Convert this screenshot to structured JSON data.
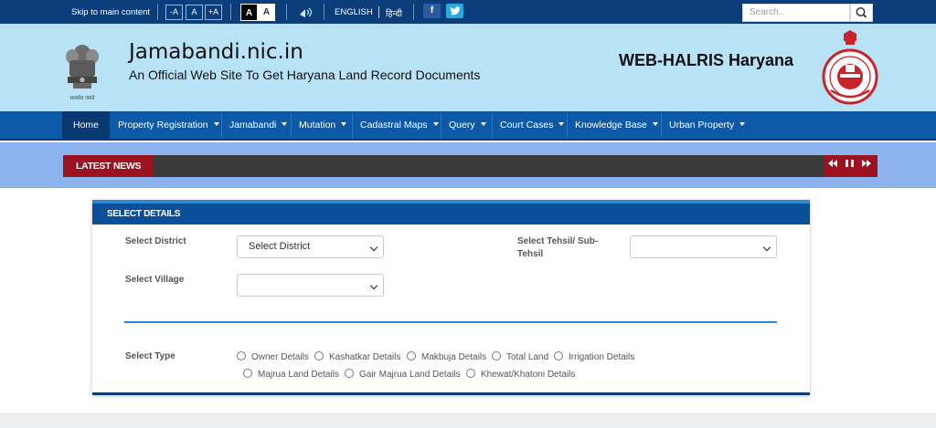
{
  "topbar": {
    "skip_link": "Skip to main content",
    "font_decrease": "-A",
    "font_normal": "A",
    "font_increase": "+A",
    "contrast_dark": "A",
    "contrast_light": "A",
    "lang_english": "ENGLISH",
    "lang_hindi": "हिन्दी",
    "facebook": "f",
    "twitter": "t",
    "search_placeholder": "Search.."
  },
  "header": {
    "title": "Jamabandi.nic.in",
    "subtitle": "An Official Web Site To Get Haryana Land Record Documents",
    "right_title": "WEB-HALRIS Haryana",
    "emblem_caption": "सत्यमेव जयते"
  },
  "nav": {
    "items": [
      {
        "label": "Home"
      },
      {
        "label": "Property Registration"
      },
      {
        "label": "Jamabandi"
      },
      {
        "label": "Mutation"
      },
      {
        "label": "Cadastral Maps"
      },
      {
        "label": "Query"
      },
      {
        "label": "Court Cases"
      },
      {
        "label": "Knowledge Base"
      },
      {
        "label": "Urban Property"
      }
    ]
  },
  "news": {
    "label": "LATEST NEWS",
    "controls": "◀◀ ❚❚ ▶▶"
  },
  "form": {
    "heading": "SELECT DETAILS",
    "district_label": "Select District",
    "district_value": "Select District",
    "tehsil_label": "Select Tehsil/ Sub-Tehsil",
    "tehsil_value": "",
    "village_label": "Select Village",
    "village_value": "",
    "type_label": "Select Type",
    "types": [
      "Owner Details",
      "Kashatkar Details",
      "Makbuja Details",
      "Total Land",
      "Irrigation Details",
      "Majrua Land Details",
      "Gair Majrua Land Details",
      "Khewat/Khatoni Details"
    ]
  },
  "colors": {
    "topbar": "#0b3d7a",
    "header_bg": "#b8e3f7",
    "nav_bg": "#0b59a7",
    "news_band": "#8cb3ee",
    "news_accent": "#9b1320",
    "panel_head": "#0b4f9a"
  }
}
